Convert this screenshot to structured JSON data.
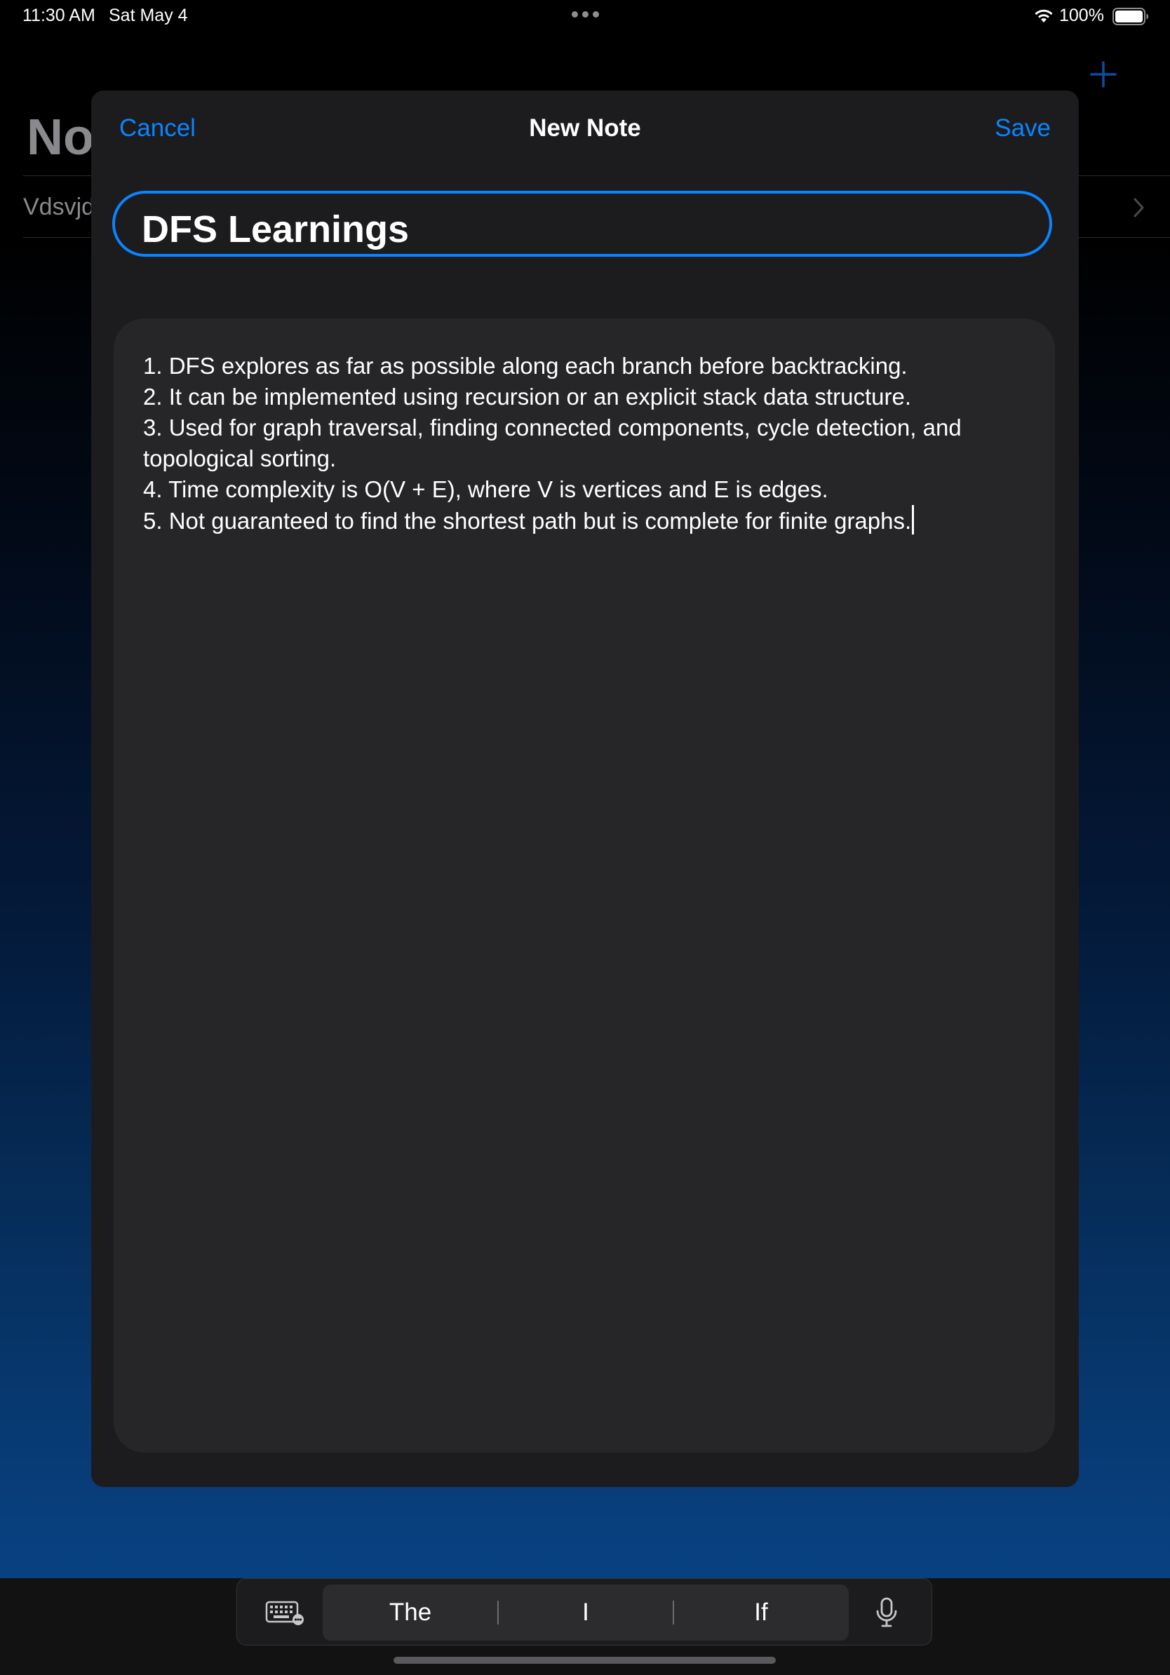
{
  "status_bar": {
    "time": "11:30 AM",
    "date": "Sat May 4",
    "battery": "100%"
  },
  "background_app": {
    "title": "No",
    "row_label": "Vdsvjd"
  },
  "sheet": {
    "cancel_label": "Cancel",
    "title": "New Note",
    "save_label": "Save",
    "note_title": "DFS Learnings",
    "note_body_lines": [
      "1. DFS explores as far as possible along each branch before backtracking.",
      "2. It can be implemented using recursion or an explicit stack data structure.",
      "3. Used for graph traversal, finding connected components, cycle detection, and",
      "topological sorting.",
      "4. Time complexity is O(V + E), where V is vertices and E is edges.",
      "5. Not guaranteed to find the shortest path but is complete for finite graphs."
    ]
  },
  "keyboard_bar": {
    "suggestions": [
      "The",
      "I",
      "If"
    ]
  },
  "colors": {
    "accent": "#0a84ff",
    "sheet_bg": "#1c1c1e",
    "body_field_bg": "#262628"
  }
}
